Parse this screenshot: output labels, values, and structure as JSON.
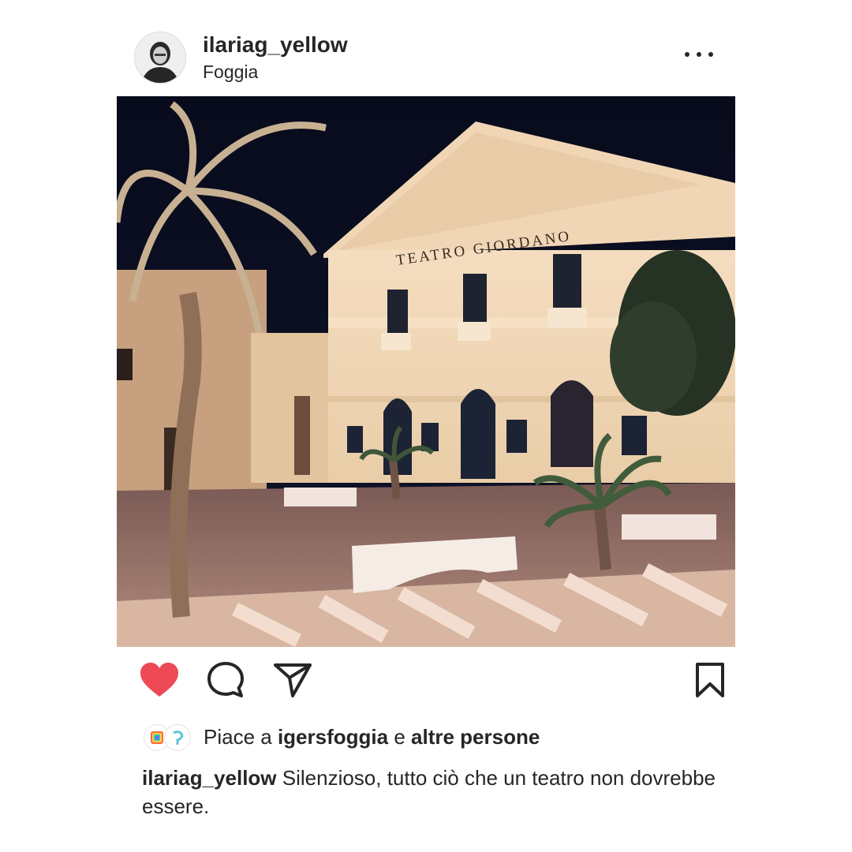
{
  "post": {
    "username": "ilariag_yellow",
    "location": "Foggia",
    "photo_sign_text": "TEATRO GIORDANO"
  },
  "icons": {
    "more": "more-options-icon",
    "like": "heart-icon",
    "comment": "comment-icon",
    "share": "share-icon",
    "save": "bookmark-icon"
  },
  "colors": {
    "like_red": "#ed4956",
    "text": "#262626"
  },
  "likes": {
    "prefix": "Piace a ",
    "user": "igersfoggia",
    "middle": " e ",
    "others": "altre persone"
  },
  "caption": {
    "username": "ilariag_yellow",
    "text": " Silenzioso, tutto ciò che un teatro non dovrebbe essere."
  }
}
